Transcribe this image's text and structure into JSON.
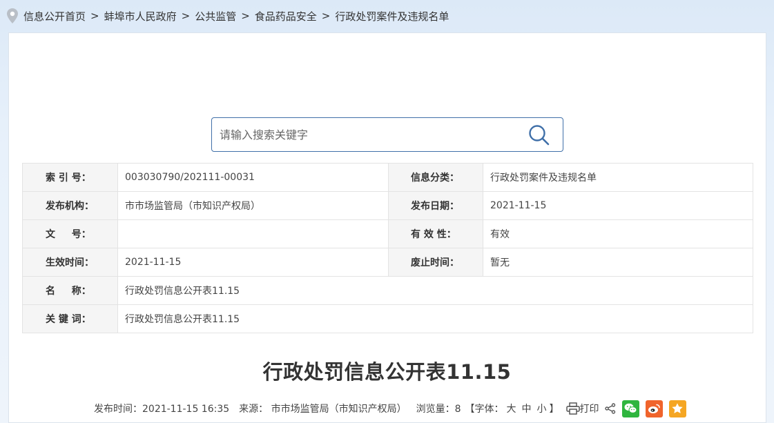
{
  "breadcrumb": {
    "items": [
      "信息公开首页",
      "蚌埠市人民政府",
      "公共监管",
      "食品药品安全",
      "行政处罚案件及违规名单"
    ],
    "separator": ">"
  },
  "search": {
    "placeholder": "请输入搜索关键字"
  },
  "meta": {
    "index_label": "索 引 号：",
    "index_value": "003030790/202111-00031",
    "category_label": "信息分类：",
    "category_value": "行政处罚案件及违规名单",
    "publisher_label": "发布机构：",
    "publisher_value": "市市场监管局（市知识产权局）",
    "pubdate_label": "发布日期：",
    "pubdate_value": "2021-11-15",
    "docno_label": "文 　 号：",
    "docno_value": "",
    "validity_label": "有 效 性：",
    "validity_value": "有效",
    "effective_label": "生效时间：",
    "effective_value": "2021-11-15",
    "repeal_label": "废止时间：",
    "repeal_value": "暂无",
    "name_label": "名 　 称：",
    "name_value": "行政处罚信息公开表11.15",
    "keywords_label": "关 键 词：",
    "keywords_value": "行政处罚信息公开表11.15"
  },
  "article": {
    "title": "行政处罚信息公开表11.15",
    "publish_time": "发布时间：2021-11-15 16:35",
    "source": "来源： 市市场监管局（市知识产权局）",
    "views": "浏览量：8",
    "font_prefix": "【字体：",
    "font_large": "大",
    "font_medium": "中",
    "font_small": "小",
    "font_suffix": "】",
    "print": "打印"
  },
  "colors": {
    "accent": "#3f6fa8",
    "wechat": "#2fb53f",
    "weibo": "#f0642c",
    "favorite": "#f5a623"
  },
  "icons": [
    "location-pin-icon",
    "search-icon",
    "printer-icon",
    "share-icon",
    "wechat-icon",
    "weibo-icon",
    "star-icon"
  ]
}
